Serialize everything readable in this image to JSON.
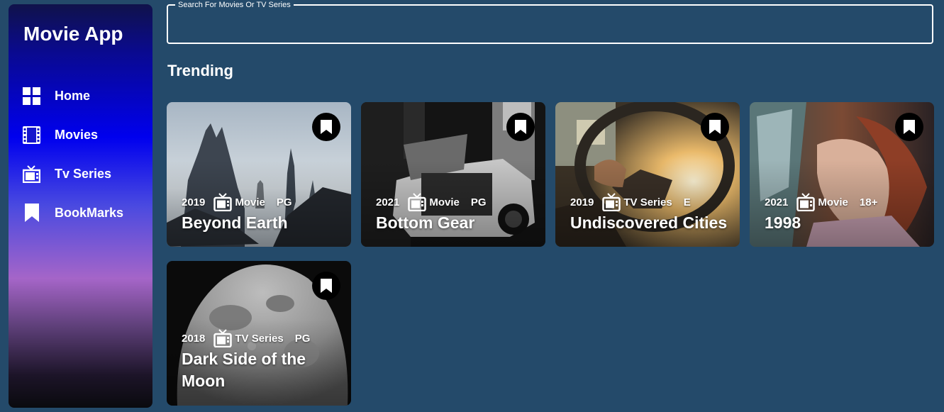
{
  "app": {
    "title": "Movie App"
  },
  "sidebar": {
    "items": [
      {
        "label": "Home",
        "icon": "grid-icon"
      },
      {
        "label": "Movies",
        "icon": "film-icon"
      },
      {
        "label": "Tv Series",
        "icon": "tv-icon"
      },
      {
        "label": "BookMarks",
        "icon": "bookmark-icon"
      }
    ]
  },
  "search": {
    "legend": "Search For Movies Or TV Series",
    "value": ""
  },
  "trending": {
    "title": "Trending",
    "cards": [
      {
        "year": "2019",
        "type": "Movie",
        "rating": "PG",
        "title": "Beyond Earth"
      },
      {
        "year": "2021",
        "type": "Movie",
        "rating": "PG",
        "title": "Bottom Gear"
      },
      {
        "year": "2019",
        "type": "TV Series",
        "rating": "E",
        "title": "Undiscovered Cities"
      },
      {
        "year": "2021",
        "type": "Movie",
        "rating": "18+",
        "title": "1998"
      },
      {
        "year": "2018",
        "type": "TV Series",
        "rating": "PG",
        "title": "Dark Side of the Moon"
      }
    ]
  },
  "colors": {
    "background": "#244a6a",
    "bookmark_button": "#000000",
    "text": "#ffffff"
  }
}
